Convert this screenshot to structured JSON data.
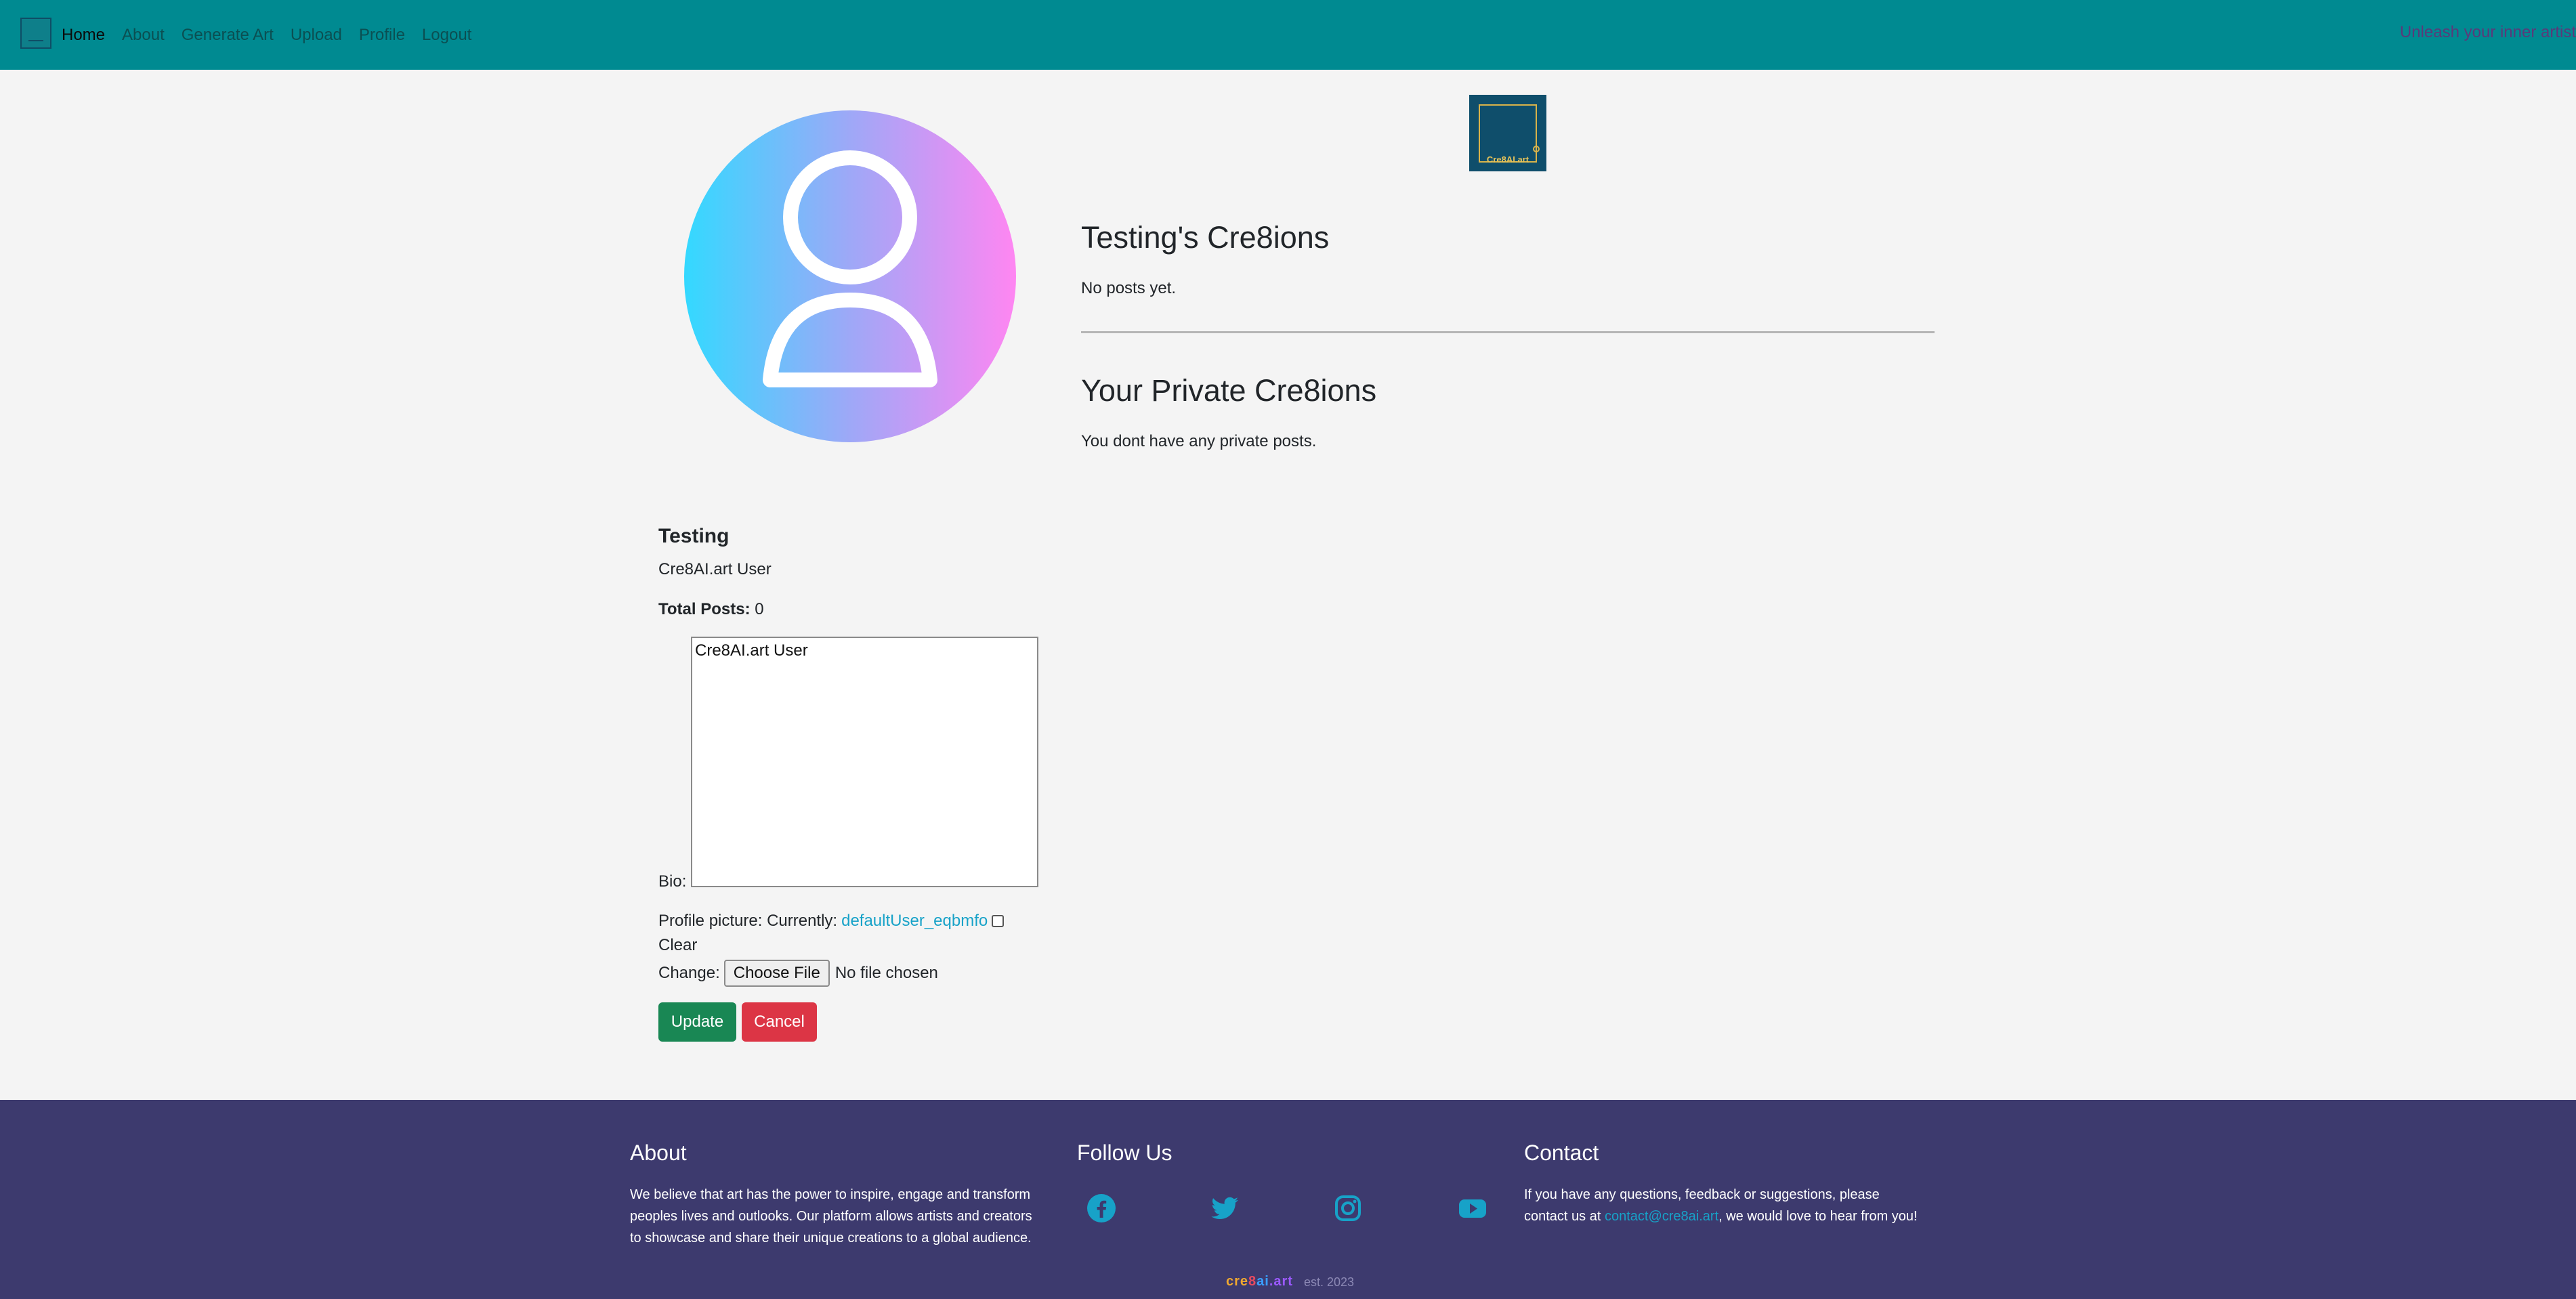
{
  "nav": {
    "links": [
      "Home",
      "About",
      "Generate Art",
      "Upload",
      "Profile",
      "Logout"
    ],
    "tagline": "Unleash your inner artist"
  },
  "site_logo": {
    "text": "Cre8AI.art"
  },
  "posts": {
    "title": "Testing's Cre8ions",
    "empty": "No posts yet."
  },
  "private": {
    "title": "Your Private Cre8ions",
    "empty": "You dont have any private posts."
  },
  "profile": {
    "username": "Testing",
    "subtitle": "Cre8AI.art User",
    "total_posts_label": "Total Posts:",
    "total_posts_value": "0",
    "bio_label": "Bio:",
    "bio_value": "Cre8AI.art User",
    "picture_label": "Profile picture: Currently:",
    "picture_link": "defaultUser_eqbmfo",
    "clear_label": "Clear",
    "change_label": "Change:",
    "choose_file": "Choose File",
    "file_status": "No file chosen",
    "update_label": "Update",
    "cancel_label": "Cancel"
  },
  "footer": {
    "about_title": "About",
    "about_lines": [
      "We believe that art has the power to inspire, engage and transform",
      "peoples lives and outlooks. Our platform allows artists and creators",
      "to showcase and share their unique creations to a global audience."
    ],
    "follow_title": "Follow Us",
    "social_icons": [
      "facebook-icon",
      "twitter-icon",
      "instagram-icon",
      "youtube-icon"
    ],
    "contact_title": "Contact",
    "contact_line1": "If you have any questions, feedback or suggestions, please",
    "contact_prefix": "contact us at ",
    "contact_email": "contact@cre8ai.art",
    "contact_suffix": ", we would love to hear from you!",
    "brand_parts": [
      "cre",
      "8",
      "ai",
      ".art"
    ],
    "est": "est. 2023"
  },
  "colors": {
    "navbar": "#008a91",
    "footer": "#3d3a6e",
    "link": "#17a2c8",
    "update": "#198754",
    "cancel": "#dc3545"
  }
}
